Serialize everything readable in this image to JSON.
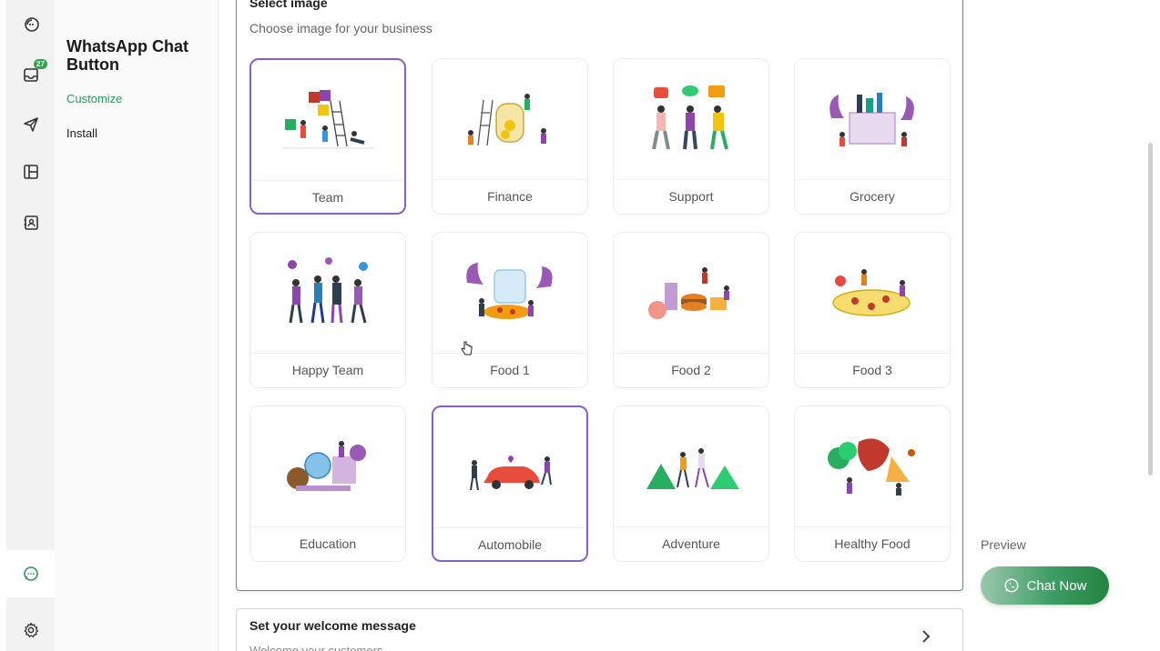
{
  "app": {
    "title": "WhatsApp Chat Button",
    "nav": [
      {
        "label": "Customize",
        "active": true
      },
      {
        "label": "Install",
        "active": false
      }
    ]
  },
  "rail": {
    "icons": [
      "chat-bubble-icon",
      "inbox-icon",
      "send-icon",
      "layout-icon",
      "contacts-icon",
      "whatsapp-chat-icon",
      "gear-icon"
    ],
    "inbox_badge": "27"
  },
  "image_panel": {
    "title": "Select image",
    "subtitle": "Choose image for your business",
    "options": [
      {
        "label": "Team",
        "selected": true
      },
      {
        "label": "Finance",
        "selected": false
      },
      {
        "label": "Support",
        "selected": false
      },
      {
        "label": "Grocery",
        "selected": false
      },
      {
        "label": "Happy Team",
        "selected": false
      },
      {
        "label": "Food 1",
        "selected": false
      },
      {
        "label": "Food 2",
        "selected": false
      },
      {
        "label": "Food 3",
        "selected": false
      },
      {
        "label": "Education",
        "selected": false
      },
      {
        "label": "Automobile",
        "selected": true
      },
      {
        "label": "Adventure",
        "selected": false
      },
      {
        "label": "Healthy Food",
        "selected": false
      }
    ]
  },
  "welcome": {
    "title": "Set your welcome message",
    "subtitle": "Welcome your customers"
  },
  "preview": {
    "label": "Preview",
    "button_label": "Chat Now"
  },
  "colors": {
    "accent_green": "#2c9a5c",
    "selected_border": "#8a5fc6",
    "button_green": "#23843f"
  }
}
